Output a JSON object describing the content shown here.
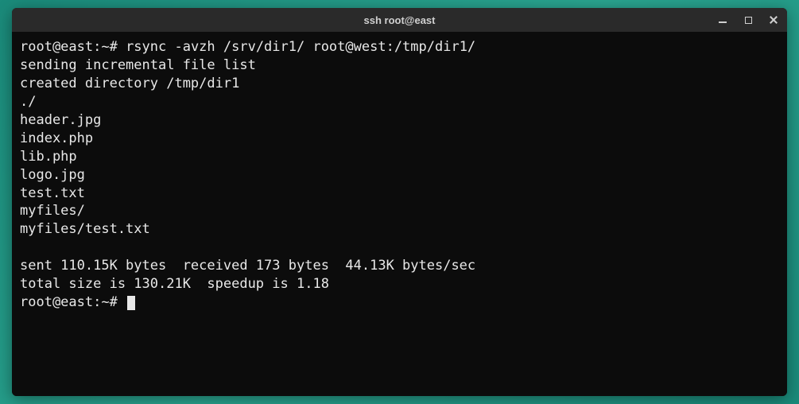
{
  "titlebar": {
    "title": "ssh root@east"
  },
  "terminal": {
    "prompt1": "root@east:~# ",
    "command1": "rsync -avzh /srv/dir1/ root@west:/tmp/dir1/",
    "lines": [
      "sending incremental file list",
      "created directory /tmp/dir1",
      "./",
      "header.jpg",
      "index.php",
      "lib.php",
      "logo.jpg",
      "test.txt",
      "myfiles/",
      "myfiles/test.txt"
    ],
    "stats_line1": "sent 110.15K bytes  received 173 bytes  44.13K bytes/sec",
    "stats_line2": "total size is 130.21K  speedup is 1.18",
    "prompt2": "root@east:~# "
  }
}
